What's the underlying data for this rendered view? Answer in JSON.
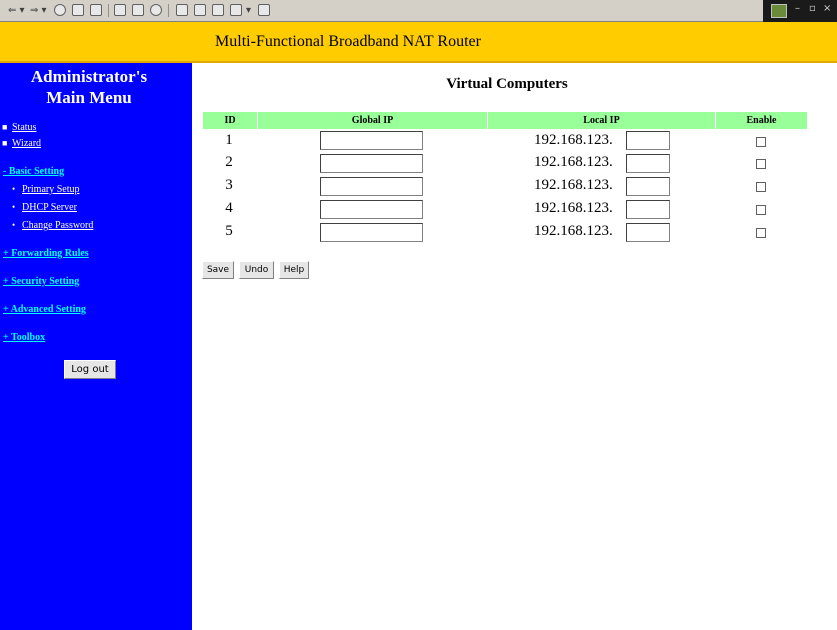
{
  "banner": {
    "title": "Multi-Functional Broadband NAT Router"
  },
  "sidebar": {
    "title_line1": "Administrator's",
    "title_line2": "Main Menu",
    "top_links": [
      "Status",
      "Wizard"
    ],
    "basic_setting": {
      "label": "- Basic Setting",
      "items": [
        "Primary Setup",
        "DHCP Server",
        "Change Password"
      ]
    },
    "sections": [
      "+ Forwarding Rules",
      "+ Security Setting",
      "+ Advanced Setting",
      "+ Toolbox"
    ],
    "logout_label": "Log out"
  },
  "main": {
    "title": "Virtual Computers",
    "columns": [
      "ID",
      "Global IP",
      "Local IP",
      "Enable"
    ],
    "local_prefix": "192.168.123.",
    "rows": [
      {
        "id": "1",
        "global_ip": "",
        "local_suffix": "",
        "enabled": false
      },
      {
        "id": "2",
        "global_ip": "",
        "local_suffix": "",
        "enabled": false
      },
      {
        "id": "3",
        "global_ip": "",
        "local_suffix": "",
        "enabled": false
      },
      {
        "id": "4",
        "global_ip": "",
        "local_suffix": "",
        "enabled": false
      },
      {
        "id": "5",
        "global_ip": "",
        "local_suffix": "",
        "enabled": false
      }
    ],
    "buttons": {
      "save": "Save",
      "undo": "Undo",
      "help": "Help"
    }
  },
  "colors": {
    "banner": "#ffcc00",
    "sidebar": "#0000ff",
    "section_link": "#00ffff",
    "table_header": "#99ff99"
  }
}
